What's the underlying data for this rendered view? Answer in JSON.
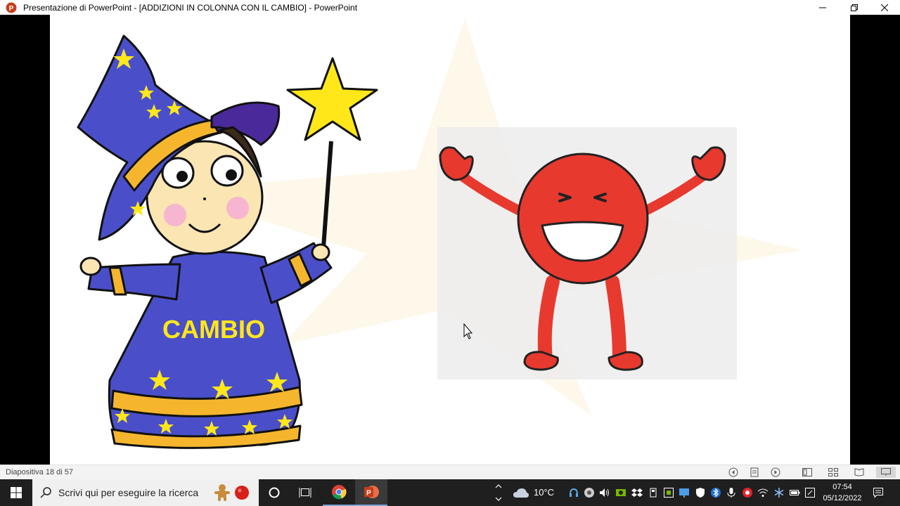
{
  "window": {
    "title": "Presentazione di PowerPoint - [ADDIZIONI IN COLONNA CON IL CAMBIO] - PowerPoint",
    "app_icon": "powerpoint-icon",
    "controls": [
      "minimize-icon",
      "restore-icon",
      "close-icon"
    ]
  },
  "slide": {
    "wizard_robe_text": "CAMBIO",
    "wizard_colors": {
      "hat": "#4a4fc9",
      "trim": "#f5b62e",
      "star": "#ffe71a"
    },
    "smiley_color": "#e8392f"
  },
  "statusbar": {
    "slide_counter": "Diapositiva 18 di 57",
    "icons": [
      "previous-icon",
      "menu-icon",
      "next-icon",
      "normal-view-icon",
      "slide-sorter-icon",
      "reading-view-icon",
      "slideshow-icon"
    ]
  },
  "taskbar": {
    "search_placeholder": "Scrivi qui per eseguire la ricerca",
    "weather_temp": "10°C",
    "time": "07:54",
    "date": "05/12/2022",
    "apps": [
      "cortana-icon",
      "task-view-icon",
      "chrome-icon",
      "powerpoint-icon"
    ]
  }
}
